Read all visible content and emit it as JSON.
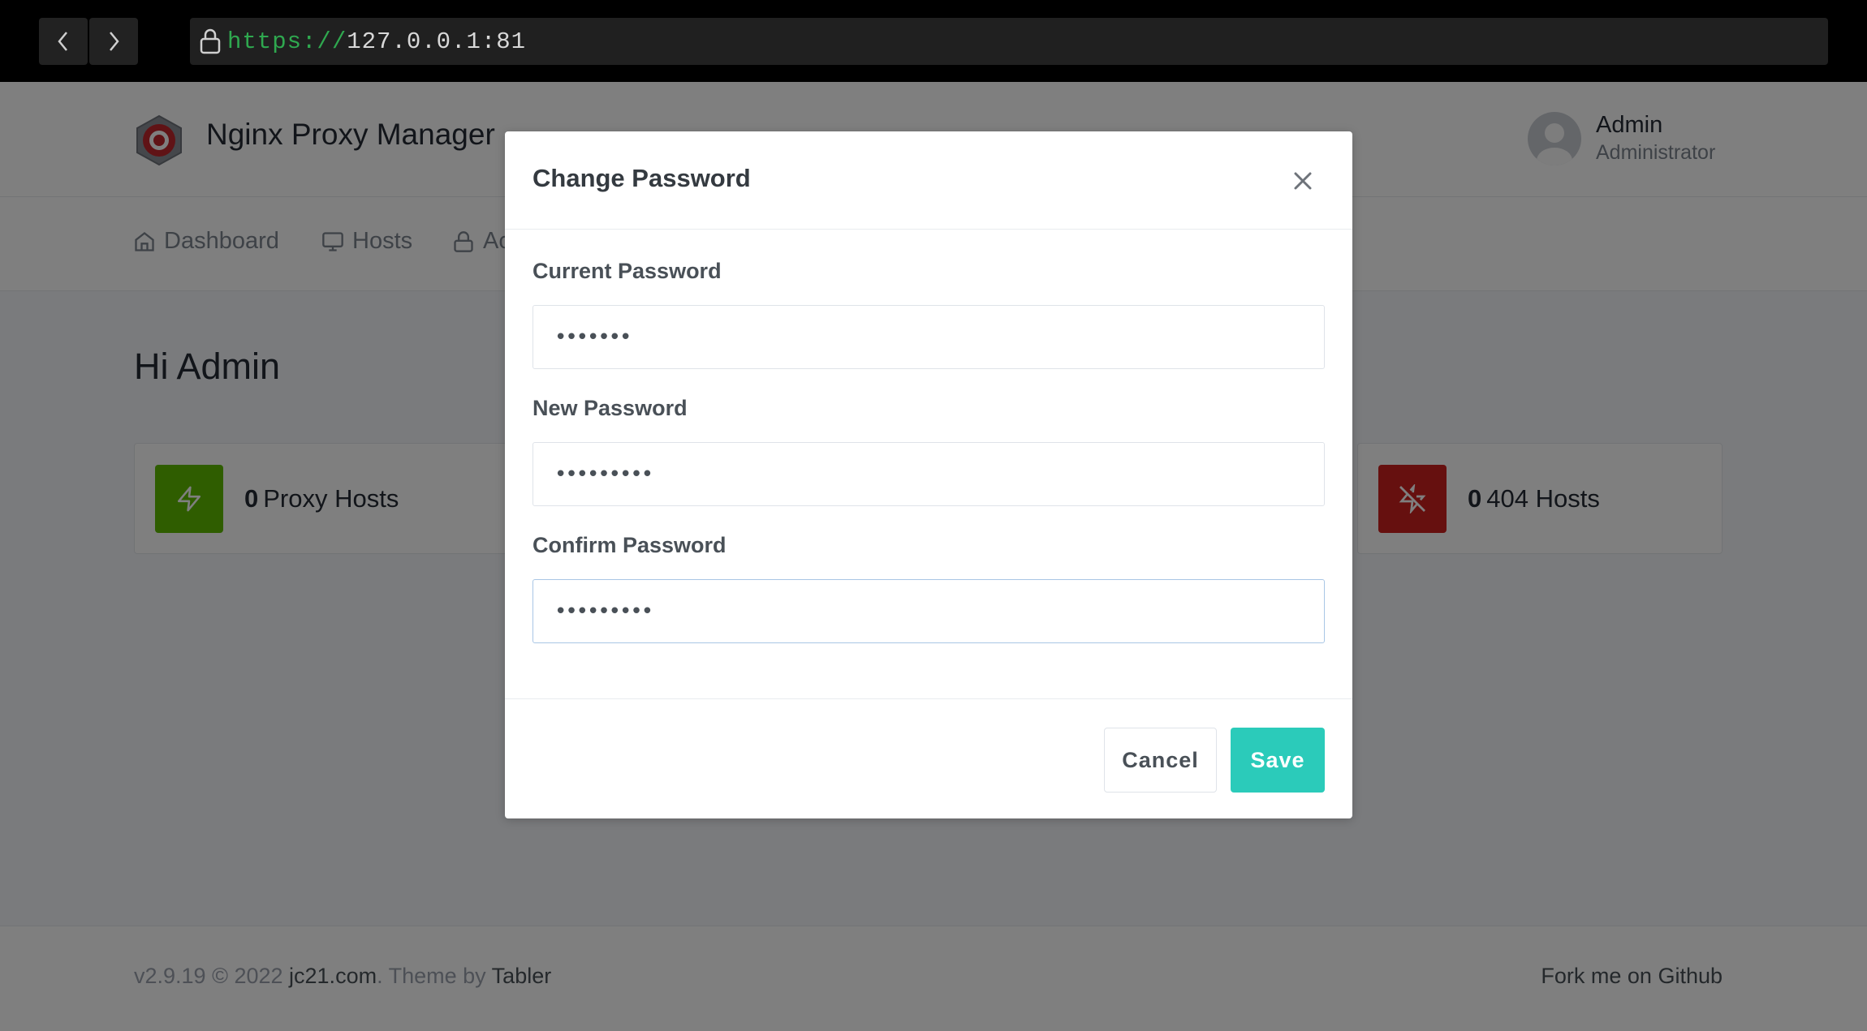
{
  "browser": {
    "url_scheme": "https://",
    "url_host": "127.0.0.1:81",
    "back_icon": "chevron-left-icon",
    "forward_icon": "chevron-right-icon",
    "lock_icon": "lock-icon"
  },
  "header": {
    "brand": "Nginx Proxy Manager",
    "user_name": "Admin",
    "user_role": "Administrator"
  },
  "nav": {
    "items": [
      {
        "label": "Dashboard",
        "icon": "home-icon"
      },
      {
        "label": "Hosts",
        "icon": "monitor-icon"
      },
      {
        "label": "Access Lists",
        "icon": "lock-icon"
      }
    ]
  },
  "main": {
    "greeting": "Hi Admin",
    "cards": [
      {
        "count": "0",
        "label": "Proxy Hosts",
        "icon": "zap-icon",
        "color": "#5eba00"
      },
      {
        "count": "0",
        "label": "404 Hosts",
        "icon": "zap-off-icon",
        "color": "#cd201f"
      }
    ]
  },
  "footer": {
    "version": "v2.9.19 © 2022 ",
    "company_link": "jc21.com",
    "theme_text": ". Theme by ",
    "theme_link": "Tabler",
    "github_link": "Fork me on Github"
  },
  "modal": {
    "title": "Change Password",
    "fields": [
      {
        "label": "Current Password",
        "value": "•••••••"
      },
      {
        "label": "New Password",
        "value": "•••••••••"
      },
      {
        "label": "Confirm Password",
        "value": "•••••••••"
      }
    ],
    "cancel_label": "Cancel",
    "save_label": "Save",
    "save_color": "#2bcbba"
  }
}
